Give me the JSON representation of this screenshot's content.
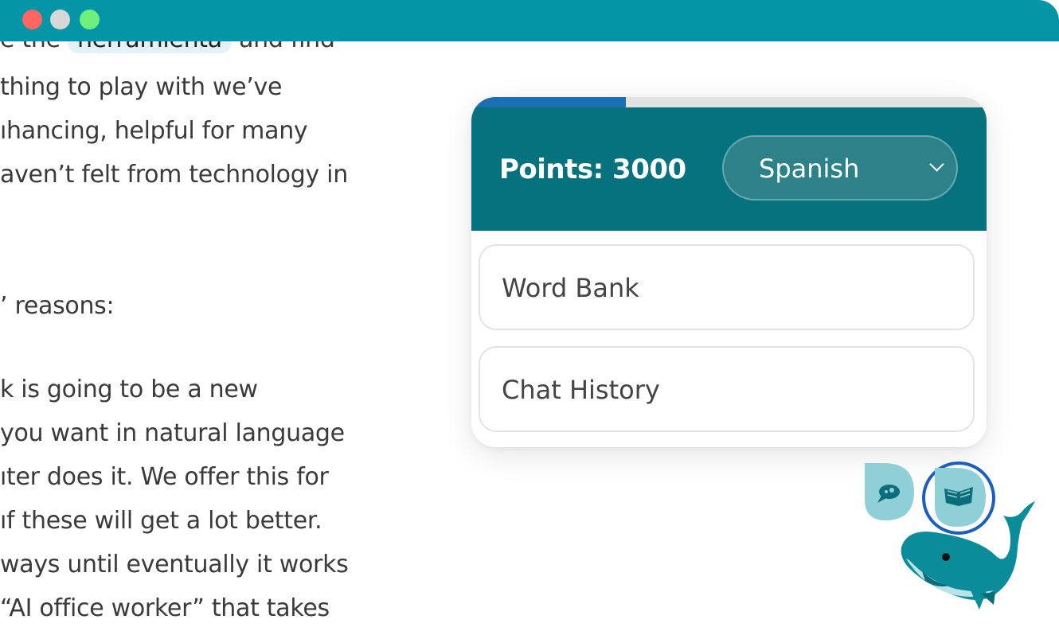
{
  "window": {
    "controls": [
      "close",
      "minimize",
      "maximize"
    ],
    "bar_color": "#0495a6"
  },
  "article": {
    "lines": [
      {
        "before": "e the ",
        "highlight": "herramienta",
        "after": " and find"
      },
      {
        "text": " thing to play with we’ve"
      },
      {
        "text": "ıhancing, helpful for many"
      },
      {
        "text": "aven’t felt from technology in"
      },
      {
        "text": "’ reasons:"
      },
      {
        "text": "k is going to be a new"
      },
      {
        "text": " you want in natural language"
      },
      {
        "text": "ıter does it. We offer this for"
      },
      {
        "text": "ıf these will get a lot better."
      },
      {
        "text": "ways until eventually it works"
      },
      {
        "text": " “AI office worker” that takes"
      }
    ]
  },
  "panel": {
    "progress_fraction": 0.3,
    "points_label": "Points: 3000",
    "language": {
      "selected": "Spanish"
    },
    "menu": {
      "word_bank": "Word Bank",
      "chat_history": "Chat History"
    },
    "colors": {
      "header": "#05727d",
      "progress": "#1a6fb5",
      "select_bg": "#2d8188"
    }
  },
  "mascot": {
    "icons": [
      "chat-bubble-icon",
      "open-book-icon",
      "whale-mascot-icon"
    ],
    "active": "open-book-icon"
  }
}
